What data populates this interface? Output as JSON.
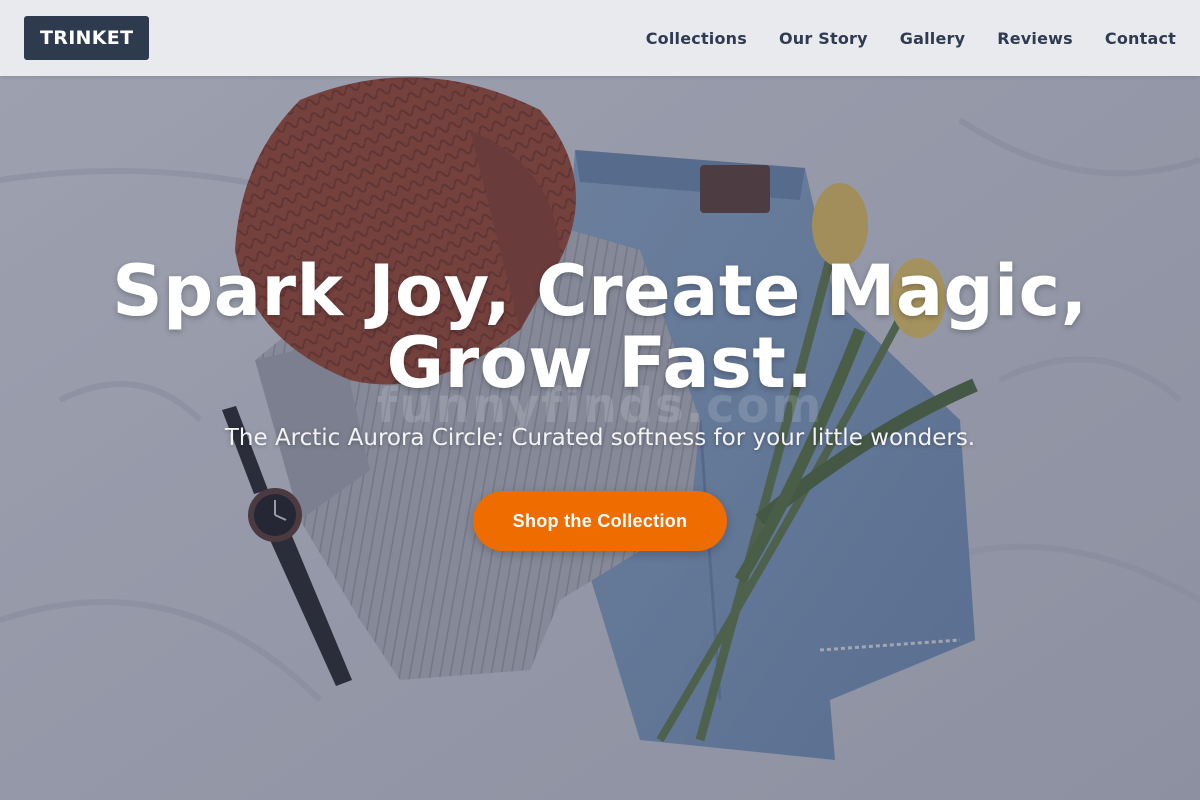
{
  "header": {
    "logo_text": "TRINKET",
    "nav": [
      {
        "label": "Collections"
      },
      {
        "label": "Our Story"
      },
      {
        "label": "Gallery"
      },
      {
        "label": "Reviews"
      },
      {
        "label": "Contact"
      }
    ]
  },
  "hero": {
    "title_line1": "Spark Joy, Create Magic,",
    "title_line2": "Grow Fast.",
    "subtitle": "The Arctic Aurora Circle: Curated softness for your little wonders.",
    "cta_label": "Shop the Collection",
    "watermark": "funnyfinds.com"
  },
  "colors": {
    "header_bg": "#ecedf0",
    "logo_bg": "#2e3a4e",
    "nav_text": "#2f3b52",
    "cta_bg": "#ef6c00",
    "hero_text": "#ffffff"
  },
  "photo_items": [
    "knit-beanie",
    "denim-jeans",
    "ribbed-sweater",
    "wrist-watch",
    "yellow-tulips",
    "bedsheet"
  ]
}
